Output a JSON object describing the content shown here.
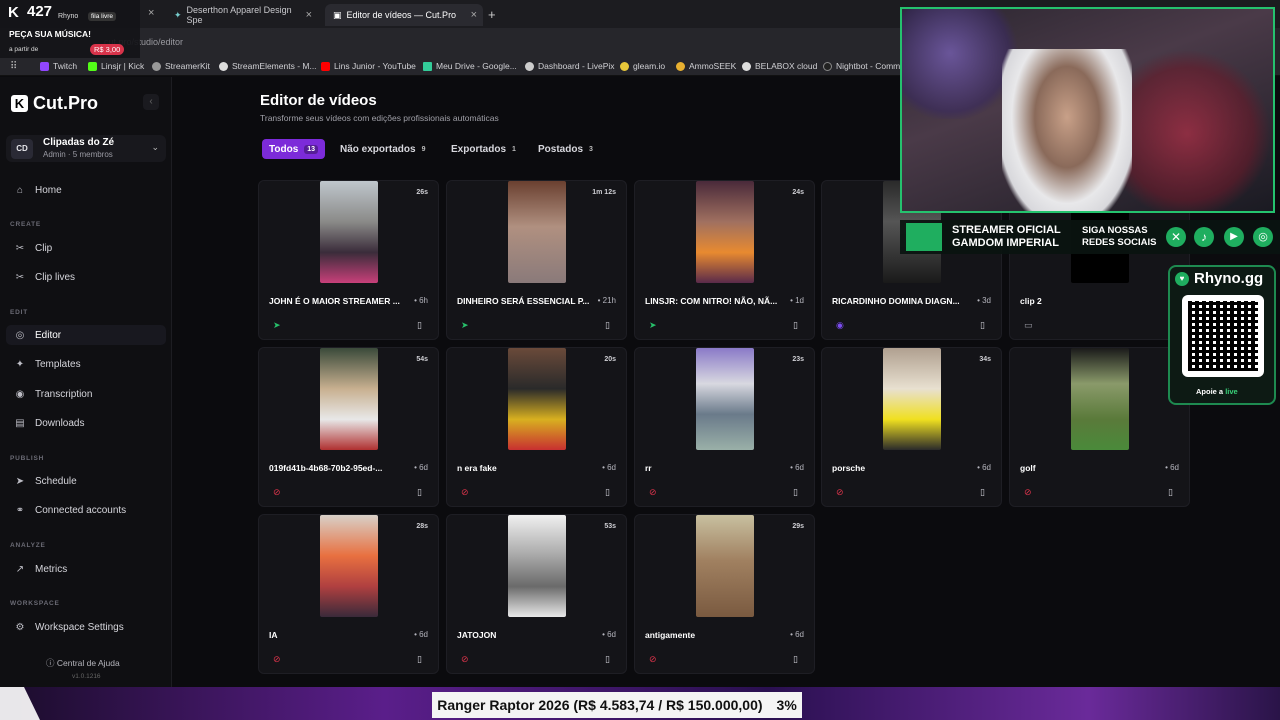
{
  "browser": {
    "tabs": [
      {
        "label": "Deserthon Apparel Design Spe",
        "active": false
      },
      {
        "label": "Editor de vídeos — Cut.Pro",
        "active": true
      }
    ],
    "url": "cut.pro/studio/editor",
    "bookmarks": [
      "Twitch",
      "Linsjr | Kick",
      "StreamerKit",
      "StreamElements - M...",
      "Lins Junior - YouTube",
      "Meu Drive - Google...",
      "Dashboard - LivePix",
      "gleam.io",
      "AmmoSEEK",
      "BELABOX cloud",
      "Nightbot - Comm"
    ]
  },
  "overlay_topleft": {
    "count": "427",
    "brand": "Rhyno",
    "badge": "fila livre",
    "cta": "PEÇA SUA MÚSICA!",
    "from_label": "a partir de",
    "price": "R$ 3,00"
  },
  "sidebar": {
    "logo": "Cut.Pro",
    "workspace": {
      "initials": "CD",
      "name": "Clipadas do Zé",
      "sub": "Admin · 5 membros"
    },
    "sections": {
      "create": "CREATE",
      "edit": "EDIT",
      "publish": "PUBLISH",
      "analyze": "ANALYZE",
      "workspace": "WORKSPACE"
    },
    "items": {
      "home": "Home",
      "clip": "Clip",
      "clip_lives": "Clip lives",
      "editor": "Editor",
      "templates": "Templates",
      "transcription": "Transcription",
      "downloads": "Downloads",
      "schedule": "Schedule",
      "connected_accounts": "Connected accounts",
      "metrics": "Metrics",
      "workspace_settings": "Workspace Settings"
    },
    "help": "Central de Ajuda",
    "version": "v1.0.1216"
  },
  "main": {
    "title": "Editor de vídeos",
    "subtitle": "Transforme seus vídeos com edições profissionais automáticas",
    "filters": [
      {
        "label": "Todos",
        "count": "13"
      },
      {
        "label": "Não exportados",
        "count": "9"
      },
      {
        "label": "Exportados",
        "count": "1"
      },
      {
        "label": "Postados",
        "count": "3"
      }
    ],
    "cards": [
      {
        "title": "JOHN É O MAIOR STREAMER ...",
        "age": "6h",
        "duration": "26s",
        "status": "posted"
      },
      {
        "title": "DINHEIRO SERÁ ESSENCIAL P...",
        "age": "21h",
        "duration": "1m 12s",
        "status": "posted"
      },
      {
        "title": "LINSJR: COM NITRO! NÃO, NÃ...",
        "age": "1d",
        "duration": "24s",
        "status": "posted"
      },
      {
        "title": "RICARDINHO DOMINA DIAGN...",
        "age": "3d",
        "duration": "",
        "status": "exported"
      },
      {
        "title": "clip 2",
        "age": "",
        "duration": "",
        "status": "draft"
      },
      {
        "title": "019fd41b-4b68-70b2-95ed-...",
        "age": "6d",
        "duration": "54s",
        "status": "not_exported"
      },
      {
        "title": "n era fake",
        "age": "6d",
        "duration": "20s",
        "status": "not_exported"
      },
      {
        "title": "rr",
        "age": "6d",
        "duration": "23s",
        "status": "not_exported"
      },
      {
        "title": "porsche",
        "age": "6d",
        "duration": "34s",
        "status": "not_exported"
      },
      {
        "title": "golf",
        "age": "6d",
        "duration": "",
        "status": "not_exported"
      },
      {
        "title": "IA",
        "age": "6d",
        "duration": "28s",
        "status": "not_exported"
      },
      {
        "title": "JATOJON",
        "age": "6d",
        "duration": "53s",
        "status": "not_exported"
      },
      {
        "title": "antigamente",
        "age": "6d",
        "duration": "29s",
        "status": "not_exported"
      }
    ]
  },
  "stream_banner": {
    "line1a": "STREAMER OFICIAL",
    "line1b": "GAMDOM IMPERIAL",
    "line2a": "SIGA NOSSAS",
    "line2b": "REDES SOCIAIS"
  },
  "rhyno_card": {
    "brand": "Rhyno.gg",
    "cta_prefix": "Apoie a",
    "cta_word": "live"
  },
  "goal_bar": {
    "text": "Ranger Raptor 2026 (R$ 4.583,74 / R$ 150.000,00)",
    "percent": "3%"
  },
  "colors": {
    "accent": "#7c2bd9",
    "posted": "#27c06a",
    "not_exported": "#d8334a",
    "exported": "#7b4cf0"
  }
}
